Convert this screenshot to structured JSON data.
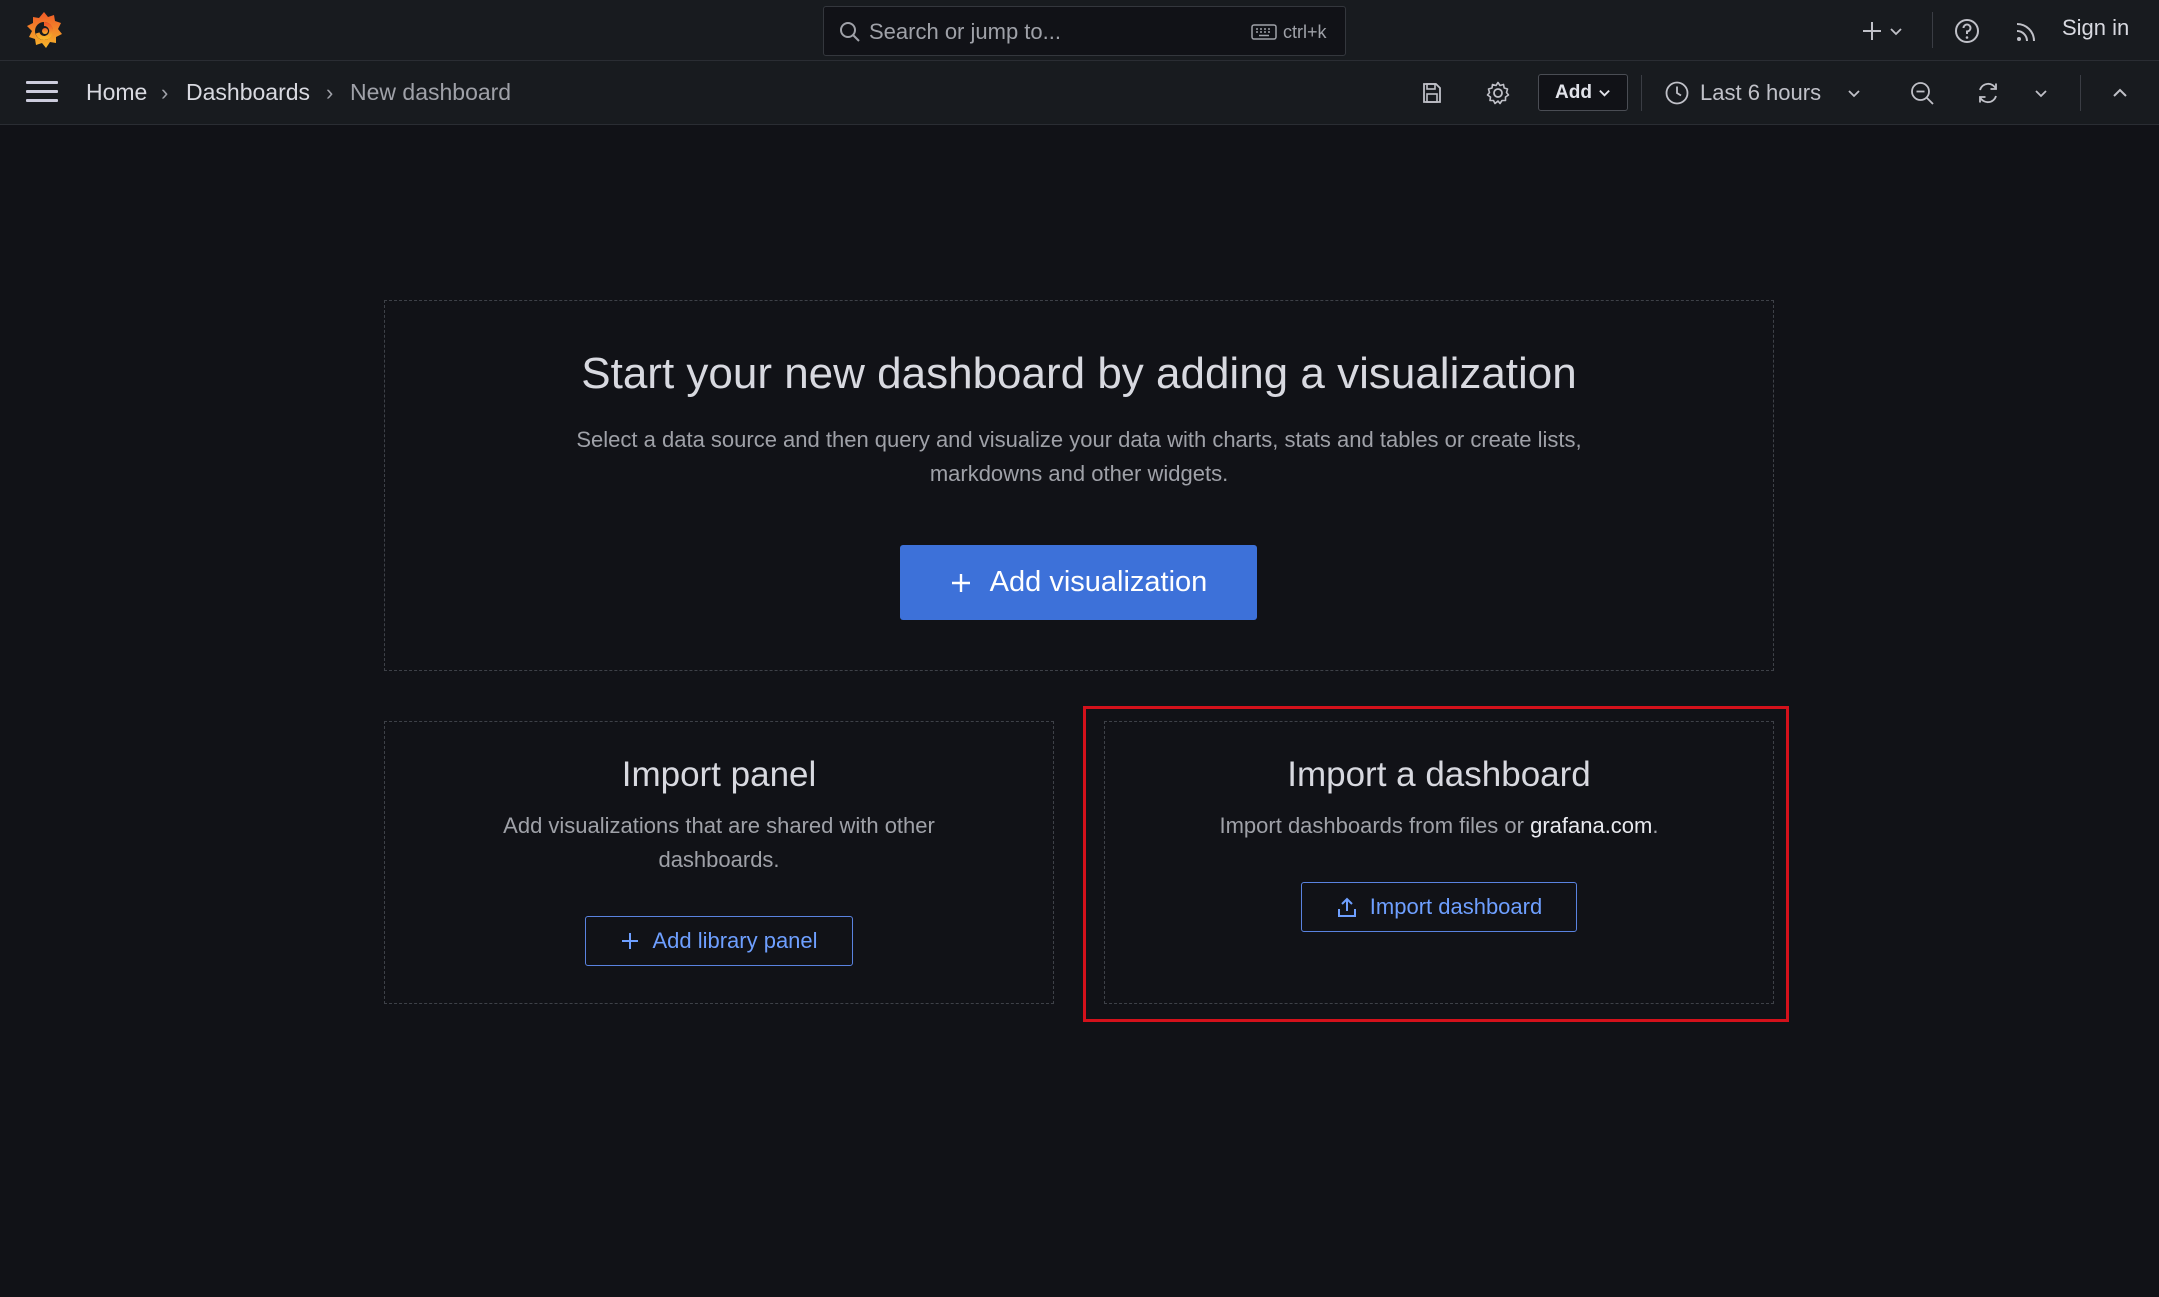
{
  "topbar": {
    "search_placeholder": "Search or jump to...",
    "search_shortcut": "ctrl+k",
    "sign_in": "Sign in"
  },
  "navbar": {
    "breadcrumbs": [
      "Home",
      "Dashboards",
      "New dashboard"
    ],
    "add_label": "Add",
    "time_range": "Last 6 hours"
  },
  "main": {
    "visualization": {
      "title": "Start your new dashboard by adding a visualization",
      "description_line1": "Select a data source and then query and visualize your data with charts, stats and tables or create lists,",
      "description_line2": "markdowns and other widgets.",
      "button_label": "Add visualization"
    },
    "import_panel": {
      "title": "Import panel",
      "description_line1": "Add visualizations that are shared with other",
      "description_line2": "dashboards.",
      "button_label": "Add library panel"
    },
    "import_dashboard": {
      "title": "Import a dashboard",
      "description_prefix": "Import dashboards from files or",
      "description_link": "grafana.com",
      "description_suffix": ".",
      "button_label": "Import dashboard"
    }
  },
  "colors": {
    "background": "#111217",
    "bar": "#181b1f",
    "primary": "#3d71d9",
    "link": "#6e9fff",
    "highlight": "#d4111b",
    "logo": "#f05a28"
  },
  "icons": [
    "grafana-logo-icon",
    "search-icon",
    "keyboard-icon",
    "plus-icon",
    "chevron-down-icon",
    "help-icon",
    "rss-icon",
    "hamburger-icon",
    "save-icon",
    "gear-icon",
    "clock-icon",
    "zoom-out-icon",
    "refresh-icon",
    "chevron-up-icon",
    "upload-icon"
  ]
}
